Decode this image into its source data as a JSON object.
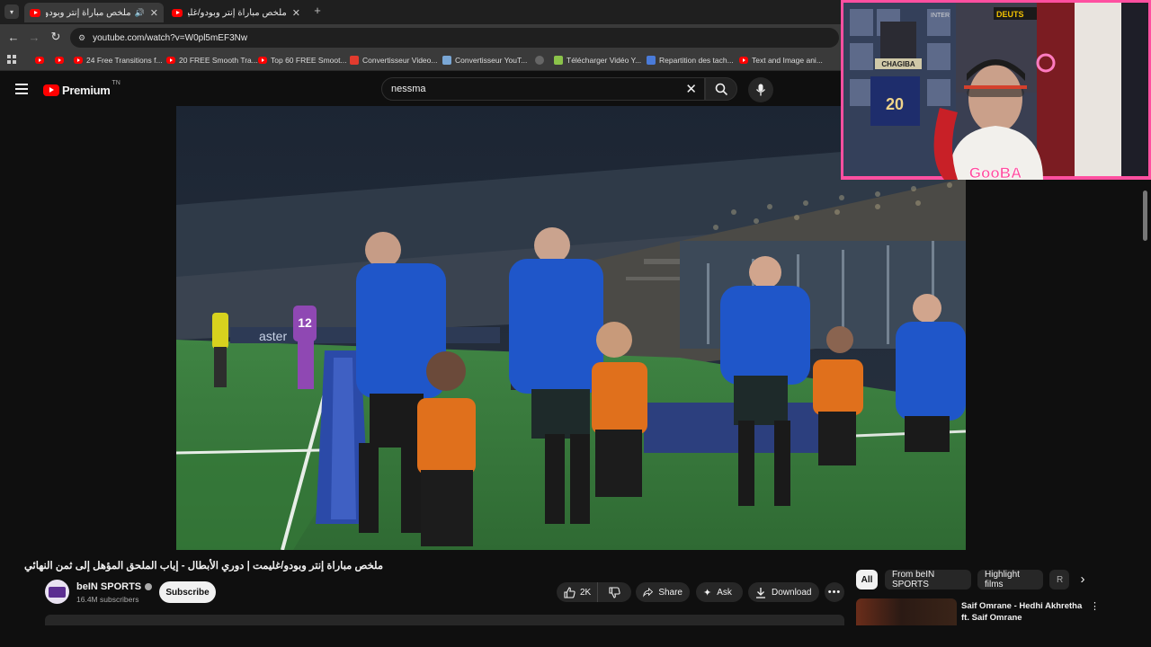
{
  "browser": {
    "tabs": [
      {
        "title": "ملخص مباراة إنتر وبودو/غليمت",
        "active": true
      },
      {
        "title": "ملخص مباراة إنتر وبودو/غليمت |",
        "active": false
      }
    ],
    "url": "youtube.com/watch?v=W0pl5mEF3Nw",
    "bookmarks": [
      {
        "label": "",
        "icon": "youtube-icon"
      },
      {
        "label": "",
        "icon": "youtube-icon"
      },
      {
        "label": "24 Free Transitions f...",
        "icon": "youtube-icon"
      },
      {
        "label": "20 FREE Smooth Tra...",
        "icon": "youtube-icon"
      },
      {
        "label": "Top 60 FREE Smoot...",
        "icon": "youtube-icon"
      },
      {
        "label": "Convertisseur Video...",
        "icon": "converter-icon"
      },
      {
        "label": "Convertisseur YouT...",
        "icon": "converter-icon"
      },
      {
        "label": "",
        "icon": "globe-icon"
      },
      {
        "label": "Télécharger Vidéo Y...",
        "icon": "download-icon"
      },
      {
        "label": "Repartition des tach...",
        "icon": "docs-icon"
      },
      {
        "label": "Text and Image ani...",
        "icon": "youtube-icon"
      }
    ]
  },
  "youtube": {
    "logo_text": "Premium",
    "logo_superscript": "TN",
    "search_value": "nessma"
  },
  "video": {
    "title": "ملخص مباراة إنتر وبودو/غليمت | دوري الأبطال - إياب الملحق المؤهل إلى ثمن النهائي",
    "channel_name": "beIN SPORTS",
    "subscribers": "16.4M subscribers",
    "subscribe_label": "Subscribe",
    "likes": "2K",
    "share_label": "Share",
    "ask_label": "Ask",
    "download_label": "Download",
    "player_number": "12",
    "board_text": "aster"
  },
  "sidebar": {
    "chips": [
      "All",
      "From beIN SPORTS",
      "Highlight films",
      "R"
    ],
    "recommended": {
      "title_line1": "Saif Omrane - Hedhi Akhretha",
      "title_line2": "ft. Saif Omrane"
    }
  },
  "webcam": {
    "overlay_text": "GooBA",
    "shirt_number": "20",
    "banner_left": "INTER",
    "banner_right": "DEUTS",
    "poster_name": "CHAGIBA"
  },
  "colors": {
    "youtube_red": "#ff0000",
    "inter_blue": "#1f56c9",
    "kid_orange": "#e0701c",
    "pitch_green": "#3a7a3c"
  }
}
